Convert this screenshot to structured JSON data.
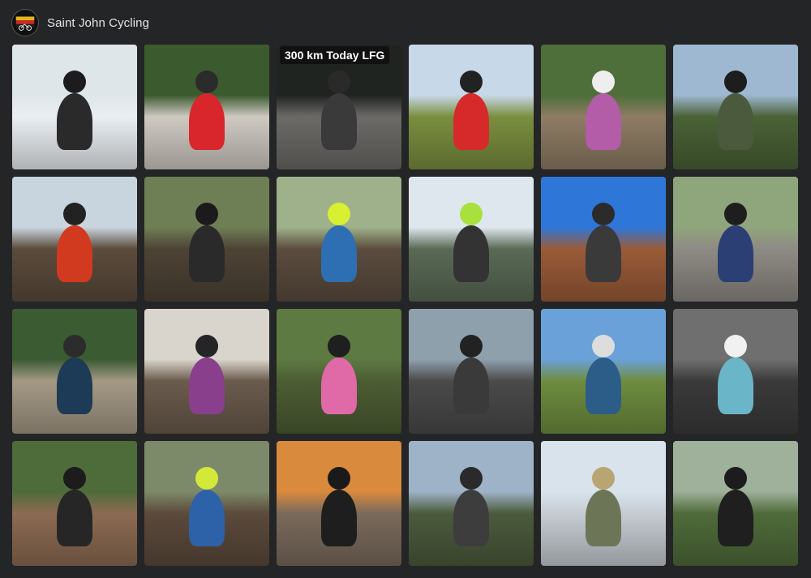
{
  "header": {
    "title": "Saint John Cycling",
    "avatar_icon": "club-logo-icon"
  },
  "tiles": [
    {
      "caption": "",
      "sky": "#dfe6ea",
      "ground": "#e9eef2",
      "fig": "#2a2a2a",
      "head": "#1c1c1c",
      "desc": "rider-under-shelter"
    },
    {
      "caption": "",
      "sky": "#3b5a2e",
      "ground": "#cfc9c2",
      "fig": "#d8262c",
      "head": "#2b2b2b",
      "desc": "group-road-ride"
    },
    {
      "caption": "300 km Today LFG",
      "sky": "#1f2421",
      "ground": "#6c6a66",
      "fig": "#3a3a3a",
      "head": "#2a2a2a",
      "desc": "road-cyclists"
    },
    {
      "caption": "",
      "sky": "#c7d8e8",
      "ground": "#7a8e3f",
      "fig": "#d62a2a",
      "head": "#222222",
      "desc": "bike-overhead"
    },
    {
      "caption": "",
      "sky": "#4e6e3a",
      "ground": "#8e7c64",
      "fig": "#b35ca8",
      "head": "#eeeeee",
      "desc": "rider-purple"
    },
    {
      "caption": "",
      "sky": "#9eb8d2",
      "ground": "#4a6136",
      "fig": "#4b5a3d",
      "head": "#1d1d1d",
      "desc": "selfie-goggles"
    },
    {
      "caption": "",
      "sky": "#c9d5de",
      "ground": "#5b4b3b",
      "fig": "#d23a20",
      "head": "#222222",
      "desc": "jump-in-woods"
    },
    {
      "caption": "",
      "sky": "#6f7f55",
      "ground": "#4d4335",
      "fig": "#2a2a2a",
      "head": "#1b1b1b",
      "desc": "rock-trail"
    },
    {
      "caption": "",
      "sky": "#9fb18a",
      "ground": "#5b4c3e",
      "fig": "#2d6fb2",
      "head": "#d9ef31",
      "desc": "blue-jersey-trail"
    },
    {
      "caption": "",
      "sky": "#dfe7ee",
      "ground": "#5a6a56",
      "fig": "#333333",
      "head": "#a8e13c",
      "desc": "selfie-green-helmet"
    },
    {
      "caption": "",
      "sky": "#2f76d9",
      "ground": "#9a5b38",
      "fig": "#3a3a3a",
      "head": "#2b2b2b",
      "desc": "red-rock-bike"
    },
    {
      "caption": "",
      "sky": "#8fa57b",
      "ground": "#8e8a84",
      "fig": "#2b3f74",
      "head": "#1e1e1e",
      "desc": "rocky-descent"
    },
    {
      "caption": "",
      "sky": "#3b5b33",
      "ground": "#a49985",
      "fig": "#1d3a56",
      "head": "#2c2c2c",
      "desc": "gravel-path"
    },
    {
      "caption": "",
      "sky": "#d9d5cc",
      "ground": "#6a5b4c",
      "fig": "#8a3f8c",
      "head": "#252525",
      "desc": "selfie-sunglasses"
    },
    {
      "caption": "",
      "sky": "#5d7a42",
      "ground": "#4c5d33",
      "fig": "#e06aa8",
      "head": "#1f1f1f",
      "desc": "costume-ride"
    },
    {
      "caption": "",
      "sky": "#8fa0ad",
      "ground": "#4a4a4a",
      "fig": "#3a3a3a",
      "head": "#222222",
      "desc": "helmet-selfie"
    },
    {
      "caption": "",
      "sky": "#6aa1d8",
      "ground": "#6e8d3f",
      "fig": "#2c5d88",
      "head": "#dddddd",
      "desc": "hill-view-bike"
    },
    {
      "caption": "",
      "sky": "#6f6f6f",
      "ground": "#3a3a3a",
      "fig": "#6ab6c8",
      "head": "#f1f1f1",
      "desc": "family-selfie"
    },
    {
      "caption": "",
      "sky": "#4e6b3a",
      "ground": "#8c6b52",
      "fig": "#262626",
      "head": "#1c1c1c",
      "desc": "rider-on-rock"
    },
    {
      "caption": "",
      "sky": "#7d8a6a",
      "ground": "#5c4a3b",
      "fig": "#2d62a8",
      "head": "#d4e83a",
      "desc": "muddy-group"
    },
    {
      "caption": "",
      "sky": "#d98a3c",
      "ground": "#7a6a5c",
      "fig": "#1e1e1e",
      "head": "#1a1a1a",
      "desc": "sunset-field"
    },
    {
      "caption": "",
      "sky": "#9fb3c8",
      "ground": "#4c5a3c",
      "fig": "#3d3d3d",
      "head": "#2a2a2a",
      "desc": "group-at-lake"
    },
    {
      "caption": "",
      "sky": "#d8e3ec",
      "ground": "#c6ccd2",
      "fig": "#6d7557",
      "head": "#b8a572",
      "desc": "speaker-event"
    },
    {
      "caption": "",
      "sky": "#9fb09b",
      "ground": "#4f6b3a",
      "fig": "#1f1f1f",
      "head": "#1c1c1c",
      "desc": "watermelons"
    }
  ]
}
